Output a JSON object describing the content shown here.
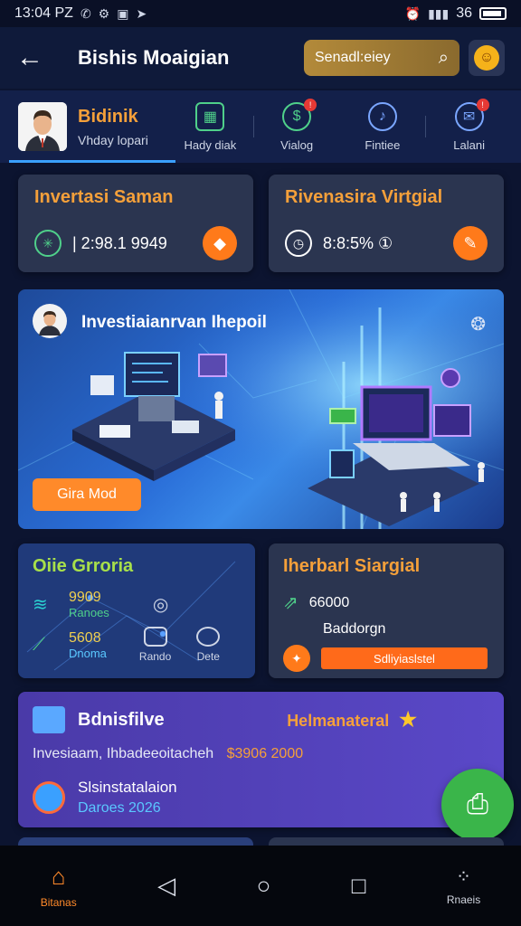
{
  "status_bar": {
    "time": "13:04 PZ",
    "left_icons": [
      "whatsapp-icon",
      "gear-icon",
      "image-icon",
      "send-icon"
    ],
    "right_text": "36"
  },
  "header": {
    "title": "Bishis Moaigian",
    "search_text": "Senadl:eiey",
    "back_icon": "back-arrow-icon",
    "search_icon": "search-icon",
    "notification_icon": "notification-face-icon"
  },
  "tabs": {
    "profile_title": "Bidinik",
    "profile_subtitle": "Vhday lopari",
    "items": [
      {
        "label": "Hady diak",
        "icon": "chart-box-icon"
      },
      {
        "label": "Vialog",
        "icon": "money-icon",
        "badge": "!"
      },
      {
        "label": "Fintiee",
        "icon": "mic-icon"
      },
      {
        "label": "Lalani",
        "icon": "chat-icon",
        "badge": "!"
      }
    ]
  },
  "cards": {
    "a": {
      "title": "Invertasi Saman",
      "value": "| 2:98.1 9949",
      "button_icon": "diamond-icon"
    },
    "b": {
      "title": "Rivenasira Virtgial",
      "value": "8:8:5% ①",
      "button_icon": "pencil-icon"
    }
  },
  "hero": {
    "title": "Investiaianrvan Ihepoil",
    "cta": "Gira Mod",
    "settings_icon": "settings-icon"
  },
  "growth": {
    "title": "Oiie Grroria",
    "row1_value": "9909",
    "row1_sub": "Ranoes",
    "row2_value": "5608",
    "row2_sub": "Dnoma",
    "mini1_label": "Rando",
    "mini2_label": "Dete"
  },
  "harvest": {
    "title": "Iherbarl Siargial",
    "value": "66000",
    "subtitle": "Baddorgn",
    "progress_label": "Sdliyiaslstel",
    "progress": 0.62
  },
  "promo": {
    "brand": "Bdnisfilve",
    "right_title": "Helmanateral",
    "line": "Invesiaam, Ihbadeeoitacheh",
    "amount": "$3906 2000",
    "sub_title": "Slsinstatalaion",
    "sub_date": "Daroes 2026"
  },
  "bottom_nav": {
    "items": [
      {
        "label": "Bitanas",
        "icon": "home-icon"
      },
      {
        "label": "",
        "icon": "back-triangle-icon"
      },
      {
        "label": "",
        "icon": "home-circle-icon"
      },
      {
        "label": "",
        "icon": "square-icon"
      },
      {
        "label": "Rnaeis",
        "icon": "grid-icon"
      }
    ]
  },
  "colors": {
    "accent": "#f5a03a",
    "orange_button": "#ff7a1a",
    "green_fab": "#3ab54a",
    "bg": "#0c1430"
  }
}
